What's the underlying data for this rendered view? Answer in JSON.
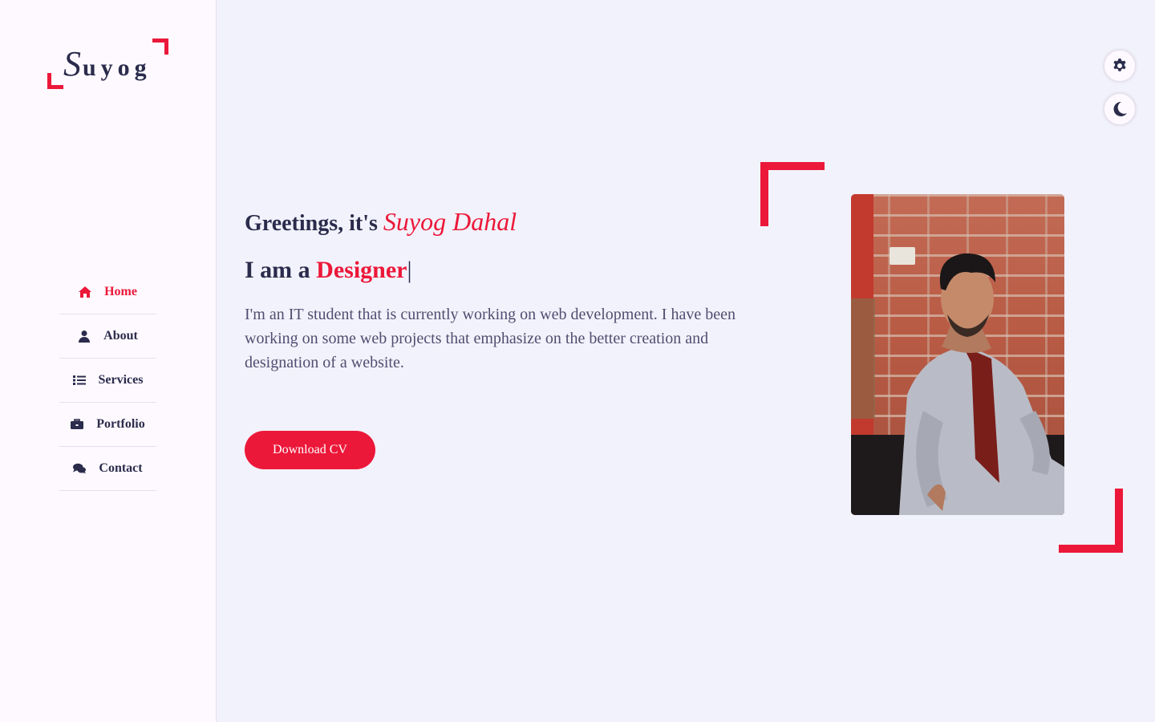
{
  "logo": {
    "first_letter": "S",
    "rest": "uyog"
  },
  "nav": {
    "items": [
      {
        "label": "Home",
        "icon": "home-icon",
        "active": true
      },
      {
        "label": "About",
        "icon": "user-icon",
        "active": false
      },
      {
        "label": "Services",
        "icon": "list-icon",
        "active": false
      },
      {
        "label": "Portfolio",
        "icon": "briefcase-icon",
        "active": false
      },
      {
        "label": "Contact",
        "icon": "comments-icon",
        "active": false
      }
    ]
  },
  "hero": {
    "greeting_prefix": "Greetings, it's ",
    "name": "Suyog Dahal",
    "role_prefix": "I am a ",
    "role": "Designer",
    "cursor": "|",
    "bio": "I'm an IT student that is currently working on web development. I have been working on some web projects that emphasize on the better creation and designation of a website.",
    "cv_button": "Download CV"
  },
  "controls": {
    "settings_icon": "gear-icon",
    "theme_icon": "moon-icon"
  },
  "colors": {
    "accent": "#ec1839",
    "text": "#2b2c4c",
    "background": "#f2f2fc",
    "sidebar": "#fdf9ff"
  }
}
